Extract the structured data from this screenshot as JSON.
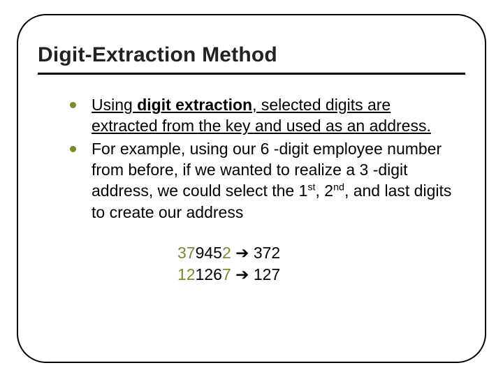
{
  "title": "Digit-Extraction Method",
  "bullets": [
    {
      "pre": "Using ",
      "term": "digit extraction",
      "post": ", selected digits are extracted from the key and used as an address."
    },
    {
      "text_before_ord": "For example, using our 6 -digit employee number from before, if we wanted to realize a 3 -digit address, we could select the 1",
      "ord1_sup": "st",
      "mid1": ", 2",
      "ord2_sup": "nd",
      "mid2": ", and last digits to create our address"
    }
  ],
  "examples": [
    {
      "a1": "3",
      "a2": "7",
      "a3": "945",
      "a4": "2",
      "arrow": "➔",
      "b": "372"
    },
    {
      "a1": "1",
      "a2": "2",
      "a3": "126",
      "a4": "7",
      "arrow": "➔",
      "b": "127"
    }
  ]
}
